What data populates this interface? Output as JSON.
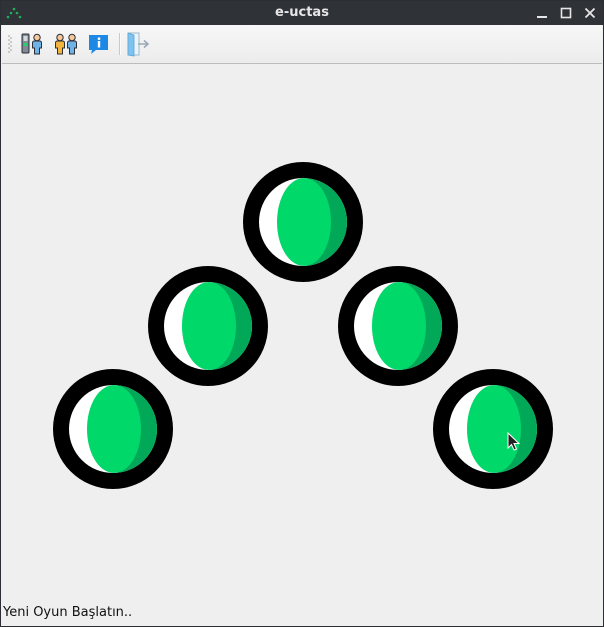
{
  "window": {
    "title": "e-uctas"
  },
  "toolbar": {
    "buttons": [
      {
        "icon": "one-player-icon"
      },
      {
        "icon": "two-players-icon"
      },
      {
        "icon": "info-icon"
      },
      {
        "icon": "exit-icon"
      }
    ]
  },
  "board": {
    "pieces": [
      {
        "color": "#00d86a",
        "shade": "#00a858"
      },
      {
        "color": "#00d86a",
        "shade": "#00a858"
      },
      {
        "color": "#00d86a",
        "shade": "#00a858"
      },
      {
        "color": "#00d86a",
        "shade": "#00a858"
      },
      {
        "color": "#00d86a",
        "shade": "#00a858"
      }
    ]
  },
  "status": {
    "text": "Yeni Oyun Başlatın.."
  },
  "colors": {
    "titlebar": "#2f3237",
    "window_bg": "#efefef",
    "ring": "#000000",
    "piece_green": "#00d86a"
  }
}
